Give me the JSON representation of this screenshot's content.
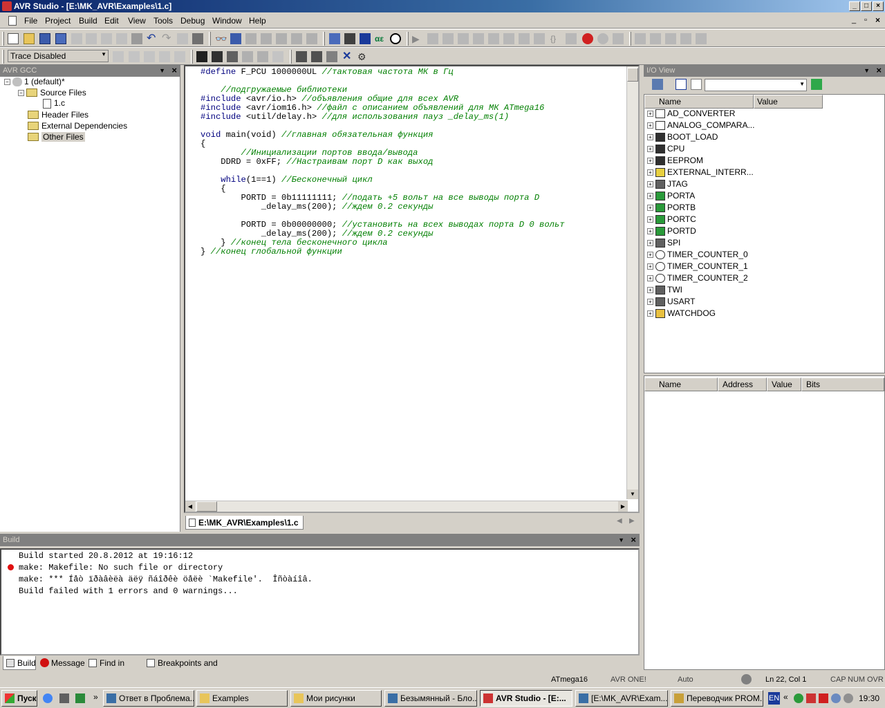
{
  "window": {
    "title": "AVR Studio - [E:\\MK_AVR\\Examples\\1.c]"
  },
  "menu": [
    "File",
    "Project",
    "Build",
    "Edit",
    "View",
    "Tools",
    "Debug",
    "Window",
    "Help"
  ],
  "toolbar": {
    "trace_select": "Trace Disabled"
  },
  "project_panel": {
    "title": "AVR GCC",
    "items": [
      {
        "label": "1 (default)*"
      },
      {
        "label": "Source Files"
      },
      {
        "label": "1.c"
      },
      {
        "label": "Header Files"
      },
      {
        "label": "External Dependencies"
      },
      {
        "label": "Other Files"
      }
    ]
  },
  "editor": {
    "tab": "E:\\MK_AVR\\Examples\\1.c",
    "lines": [
      "#define F_PCU 1000000UL //тактовая частота МК в Гц",
      "",
      "    //подгружаемые библиотеки",
      "#include <avr/io.h> //объявления общие для всех AVR",
      "#include <avr/iom16.h> //файл с описанием объявлений для МК ATmega16",
      "#include <util/delay.h> //для использования пауз _delay_ms(1)",
      "",
      "void main(void) //главная обязательная функция",
      "{",
      "        //Инициализации портов ввода/вывода",
      "    DDRD = 0xFF; //Настраивам порт D как выход",
      "",
      "    while(1==1) //Бесконечный цикл",
      "    {",
      "        PORTD = 0b11111111; //подать +5 вольт на все выводы порта D",
      "            _delay_ms(200); //ждем 0.2 секунды",
      "",
      "        PORTD = 0b00000000; //установить на всех выводах порта D 0 вольт",
      "            _delay_ms(200); //ждем 0.2 секунды",
      "    } //конец тела бесконечного цикла",
      "} //конец глобальной функции"
    ]
  },
  "io_view": {
    "title": "I/O View",
    "columns": [
      "Name",
      "Value"
    ],
    "items": [
      "AD_CONVERTER",
      "ANALOG_COMPARA...",
      "BOOT_LOAD",
      "CPU",
      "EEPROM",
      "EXTERNAL_INTERR...",
      "JTAG",
      "PORTA",
      "PORTB",
      "PORTC",
      "PORTD",
      "SPI",
      "TIMER_COUNTER_0",
      "TIMER_COUNTER_1",
      "TIMER_COUNTER_2",
      "TWI",
      "USART",
      "WATCHDOG"
    ],
    "detail_columns": [
      "Name",
      "Address",
      "Value",
      "Bits"
    ]
  },
  "build_panel": {
    "title": "Build",
    "lines": [
      "Build started 20.8.2012 at 19:16:12",
      "make: Makefile: No such file or directory",
      "make: *** Íåò ïðàâèëà äëÿ ñáîðêè öåëè `Makefile'.  Îñòàíîâ.",
      "Build failed with 1 errors and 0 warnings..."
    ],
    "tabs": [
      "Build",
      "Message",
      "Find in Files",
      "Breakpoints and Tracepoints"
    ]
  },
  "status": {
    "device": "ATmega16",
    "tool": "AVR ONE!",
    "mode": "Auto",
    "position": "Ln 22, Col 1",
    "caps": "CAP",
    "num": "NUM",
    "ovr": "OVR"
  },
  "taskbar": {
    "start": "Пуск",
    "tasks": [
      "Ответ в Проблема...",
      "Examples",
      "Мои рисунки",
      "Безымянный - Бло...",
      "AVR Studio - [E:...",
      "[E:\\MK_AVR\\Exam...",
      "Переводчик PROM..."
    ],
    "lang": "EN",
    "clock": "19:30"
  }
}
